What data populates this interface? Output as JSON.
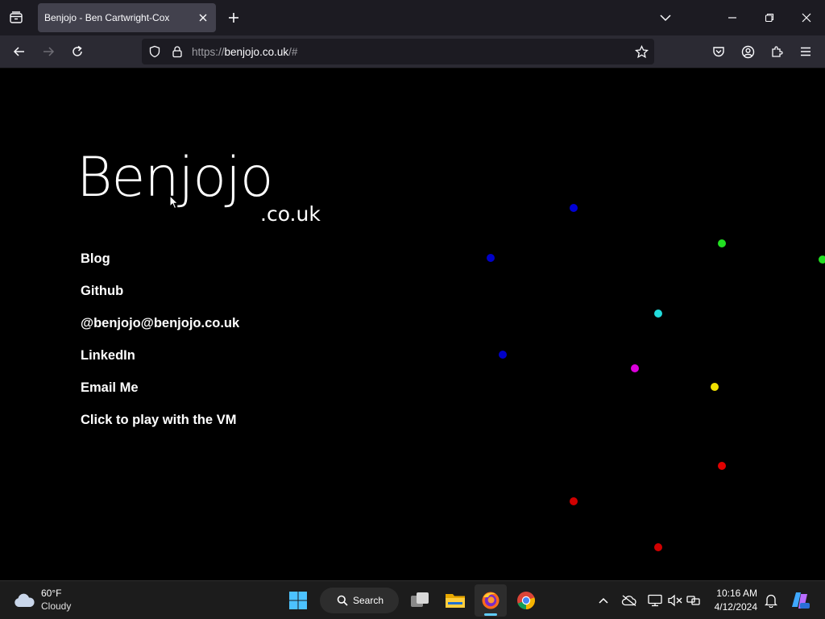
{
  "browser": {
    "tab_title": "Benjojo - Ben Cartwright-Cox",
    "url_scheme": "https://",
    "url_host": "benjojo.co.uk",
    "url_path": "/#"
  },
  "page": {
    "logo_main": "Benjojo",
    "logo_sub": ".co.uk",
    "links": [
      "Blog",
      "Github",
      "@benjojo@benjojo.co.uk",
      "LinkedIn",
      "Email Me",
      "Click to play with the VM"
    ],
    "dot_colors": [
      "#0000d6",
      "#22e022",
      "#0000c8",
      "#22e022",
      "#22dcdc",
      "#0000c8",
      "#dc00dc",
      "#f0e000",
      "#e00000",
      "#d00000",
      "#d00000"
    ]
  },
  "taskbar": {
    "weather_temp": "60°F",
    "weather_desc": "Cloudy",
    "search_label": "Search",
    "time": "10:16 AM",
    "date": "4/12/2024"
  },
  "icons": {
    "tab_list": "tab-list-icon",
    "new_tab": "plus-icon",
    "back": "back-arrow-icon",
    "forward": "forward-arrow-icon",
    "reload": "reload-icon",
    "shield": "shield-icon",
    "lock": "lock-icon",
    "bookmark": "star-icon",
    "pocket": "pocket-icon",
    "account": "account-icon",
    "extensions": "puzzle-icon",
    "menu": "hamburger-icon"
  }
}
